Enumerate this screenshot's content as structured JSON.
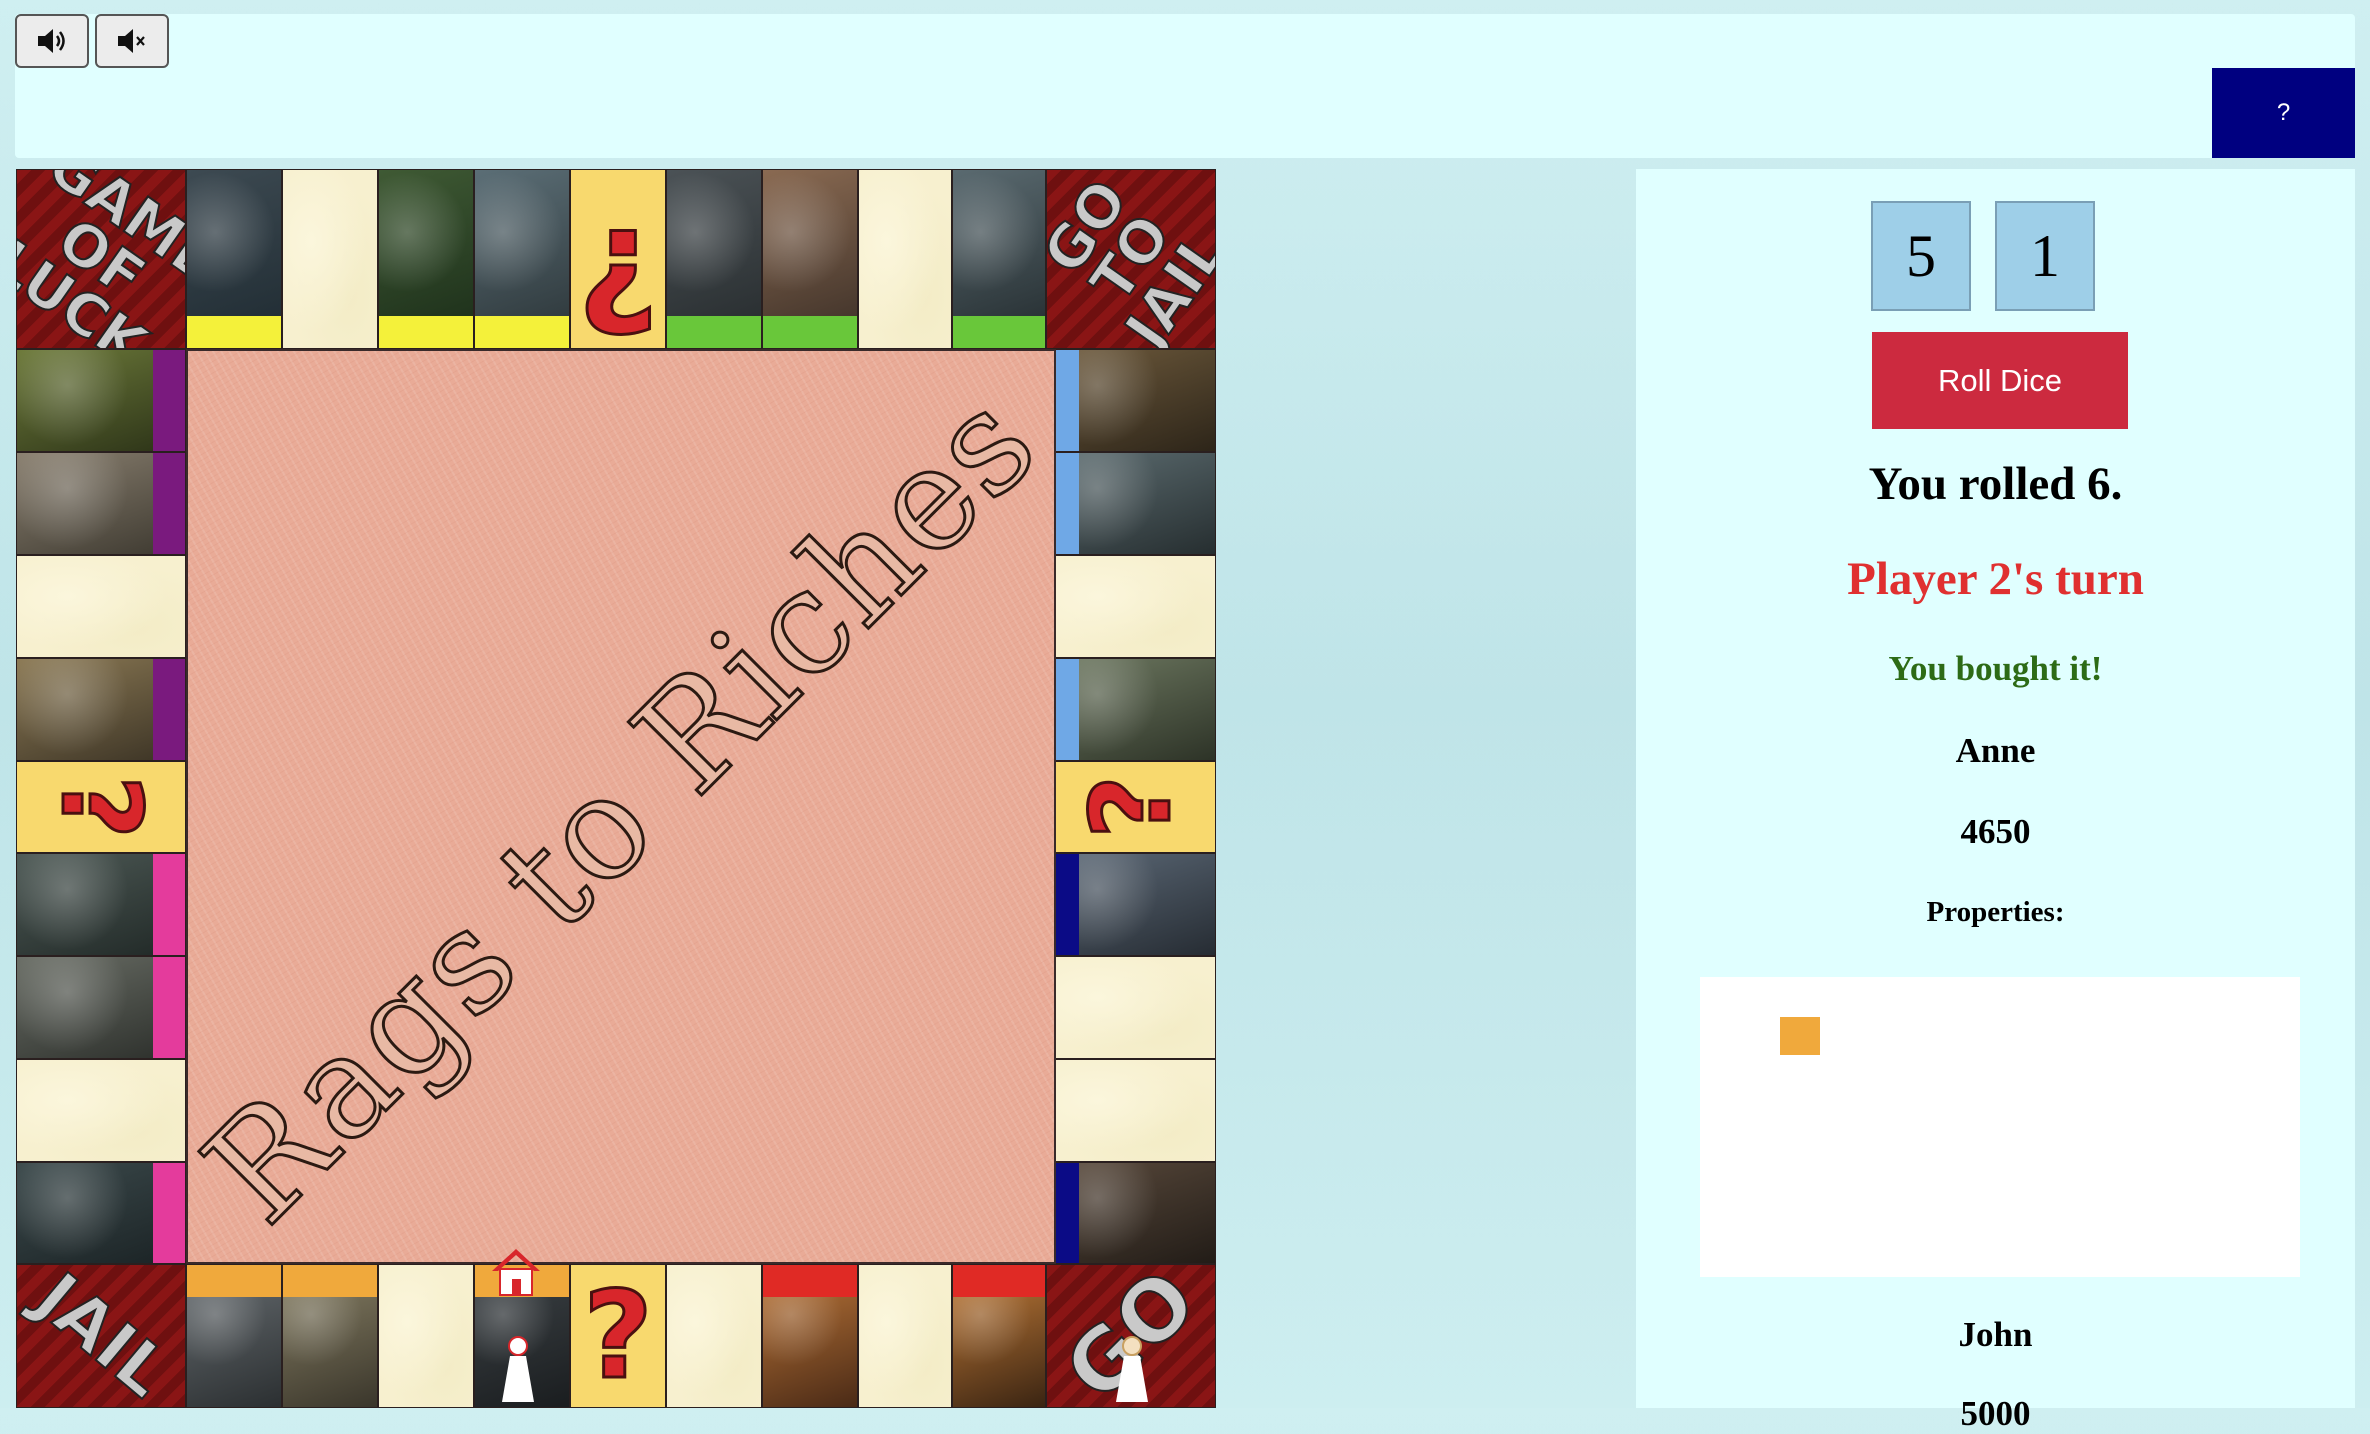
{
  "toolbar": {
    "sound_on_icon": "speaker-on-icon",
    "sound_off_icon": "speaker-mute-icon",
    "help_label": "?"
  },
  "board": {
    "title": "Rags to Riches",
    "corners": {
      "top_left": "GAME OF LUCK",
      "top_right": "GO TO JAIL",
      "bottom_left": "JAIL",
      "bottom_right": "GO"
    },
    "chance_glyph_top": "¿",
    "chance_glyph_side": "?",
    "colors": {
      "yellow": "#f4f13a",
      "green": "#69c73a",
      "purple": "#7a1a7e",
      "pink": "#e43b9c",
      "lightblue": "#6fa8e6",
      "navy": "#0b0b86",
      "orange": "#f0a93c",
      "red": "#e02a25"
    }
  },
  "dice": {
    "die1": "5",
    "die2": "1"
  },
  "panel": {
    "roll_button": "Roll Dice",
    "rolled_text": "You rolled 6.",
    "turn_text": "Player 2's turn",
    "turn_color": "#e03030",
    "action_text": "You bought it!",
    "action_color": "#2d6b16",
    "properties_label": "Properties:"
  },
  "players": [
    {
      "name": "Anne",
      "money": "4650",
      "properties": [
        {
          "color": "#f0a93c"
        }
      ]
    },
    {
      "name": "John",
      "money": "5000"
    }
  ]
}
